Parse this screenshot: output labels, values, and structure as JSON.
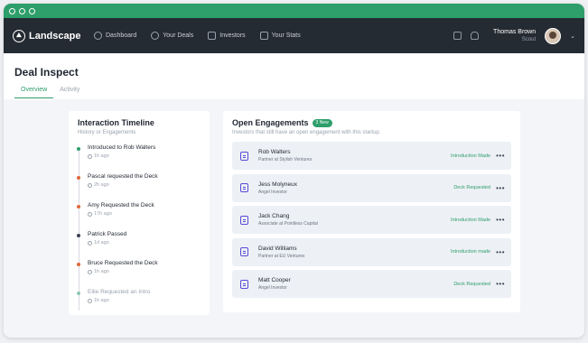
{
  "app": {
    "brand": "Landscape"
  },
  "nav": {
    "items": [
      {
        "label": "Dashboard",
        "icon": "dashboard-icon"
      },
      {
        "label": "Your Deals",
        "icon": "globe-icon"
      },
      {
        "label": "Investors",
        "icon": "person-icon"
      },
      {
        "label": "Your Stats",
        "icon": "chart-icon"
      }
    ]
  },
  "user": {
    "name": "Thomas Brown",
    "role": "Scout"
  },
  "page": {
    "title": "Deal Inspect",
    "tabs": [
      {
        "label": "Overview"
      },
      {
        "label": "Activity"
      }
    ]
  },
  "timeline": {
    "title": "Interaction Timeline",
    "subtitle": "History or Engagements",
    "items": [
      {
        "title": "Introduced to Rob Walters",
        "time": "1h ago",
        "color": "#2e9e6a"
      },
      {
        "title": "Pascal requested the Deck",
        "time": "2h ago",
        "color": "#e0673a"
      },
      {
        "title": "Amy Requested the Deck",
        "time": "17h ago",
        "color": "#e0673a"
      },
      {
        "title": "Patrick Passed",
        "time": "1d ago",
        "color": "#3a4250"
      },
      {
        "title": "Bruce Requested the Deck",
        "time": "1h ago",
        "color": "#e0673a"
      },
      {
        "title": "Ellie Requested an Intro",
        "time": "1h ago",
        "color": "#2e9e6a"
      }
    ]
  },
  "engagements": {
    "title": "Open Engagements",
    "badge": "3 New",
    "subtitle": "Investors that still have an open engagement with this startup.",
    "items": [
      {
        "name": "Rob Walters",
        "role": "Partner at Stylish Ventures",
        "status": "Introduction Made"
      },
      {
        "name": "Jess Molyneux",
        "role": "Angel Investor",
        "status": "Deck Requested"
      },
      {
        "name": "Jack Chang",
        "role": "Associate at Pointless Capital",
        "status": "Introduction Made"
      },
      {
        "name": "David Williams",
        "role": "Partner at EU Ventures",
        "status": "Introduction made"
      },
      {
        "name": "Matt Cooper",
        "role": "Angel Investor",
        "status": "Deck Requested"
      }
    ]
  },
  "colors": {
    "accent": "#2e9e6a",
    "navbar": "#252b33",
    "icon": "#5b4bd5"
  }
}
